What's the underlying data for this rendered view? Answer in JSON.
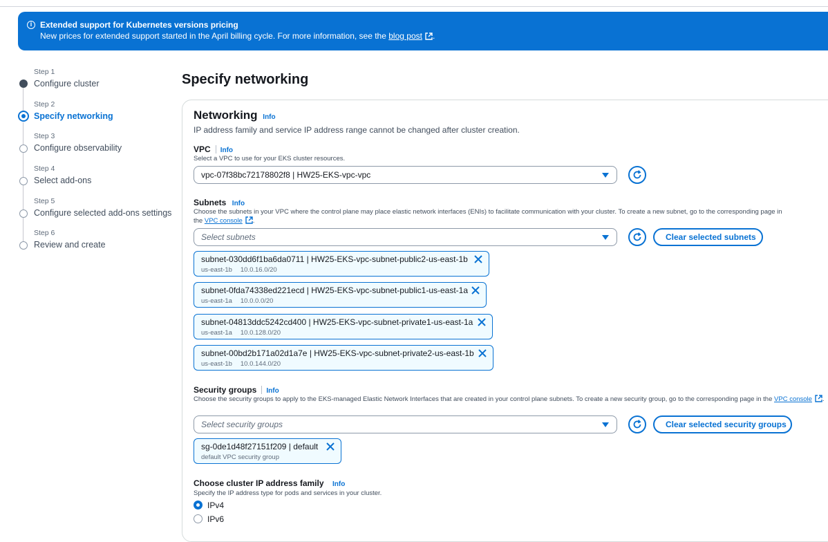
{
  "banner": {
    "title": "Extended support for Kubernetes versions pricing",
    "text": "New prices for extended support started in the April billing cycle. For more information, see the",
    "link": "blog post",
    "suffix": "."
  },
  "steps": [
    {
      "num": "Step 1",
      "name": "Configure cluster",
      "state": "done"
    },
    {
      "num": "Step 2",
      "name": "Specify networking",
      "state": "active"
    },
    {
      "num": "Step 3",
      "name": "Configure observability",
      "state": "pending"
    },
    {
      "num": "Step 4",
      "name": "Select add-ons",
      "state": "pending"
    },
    {
      "num": "Step 5",
      "name": "Configure selected add-ons settings",
      "state": "pending"
    },
    {
      "num": "Step 6",
      "name": "Review and create",
      "state": "pending"
    }
  ],
  "page_title": "Specify networking",
  "networking": {
    "title": "Networking",
    "info": "Info",
    "description": "IP address family and service IP address range cannot be changed after cluster creation."
  },
  "vpc": {
    "label": "VPC",
    "info": "Info",
    "description": "Select a VPC to use for your EKS cluster resources.",
    "value": "vpc-07f38bc72178802f8 | HW25-EKS-vpc-vpc"
  },
  "subnets": {
    "label": "Subnets",
    "info": "Info",
    "description": "Choose the subnets in your VPC where the control plane may place elastic network interfaces (ENIs) to facilitate communication with your cluster. To create a new subnet, go to the corresponding page in",
    "description_prefix2": "the",
    "link": "VPC console",
    "suffix": ".",
    "placeholder": "Select subnets",
    "clear_button": "Clear selected subnets",
    "selected": [
      {
        "title": "subnet-030dd6f1ba6da0711 | HW25-EKS-vpc-subnet-public2-us-east-1b",
        "az": "us-east-1b",
        "cidr": "10.0.16.0/20"
      },
      {
        "title": "subnet-0fda74338ed221ecd | HW25-EKS-vpc-subnet-public1-us-east-1a",
        "az": "us-east-1a",
        "cidr": "10.0.0.0/20"
      },
      {
        "title": "subnet-04813ddc5242cd400 | HW25-EKS-vpc-subnet-private1-us-east-1a",
        "az": "us-east-1a",
        "cidr": "10.0.128.0/20"
      },
      {
        "title": "subnet-00bd2b171a02d1a7e | HW25-EKS-vpc-subnet-private2-us-east-1b",
        "az": "us-east-1b",
        "cidr": "10.0.144.0/20"
      }
    ]
  },
  "security_groups": {
    "label": "Security groups",
    "info": "Info",
    "description": "Choose the security groups to apply to the EKS-managed Elastic Network Interfaces that are created in your control plane subnets. To create a new security group, go to the corresponding page in the",
    "link": "VPC console",
    "suffix": ".",
    "placeholder": "Select security groups",
    "clear_button": "Clear selected security groups",
    "selected": [
      {
        "title": "sg-0de1d48f27151f209 | default",
        "desc": "default VPC security group"
      }
    ]
  },
  "ip_family": {
    "label": "Choose cluster IP address family",
    "info": "Info",
    "description": "Specify the IP address type for pods and services in your cluster.",
    "options": [
      "IPv4",
      "IPv6"
    ],
    "selected": "IPv4"
  },
  "colors": {
    "primary": "#0972d3",
    "text": "#16191f",
    "muted": "#5f6b7a",
    "token_bg": "#f0fbff"
  }
}
